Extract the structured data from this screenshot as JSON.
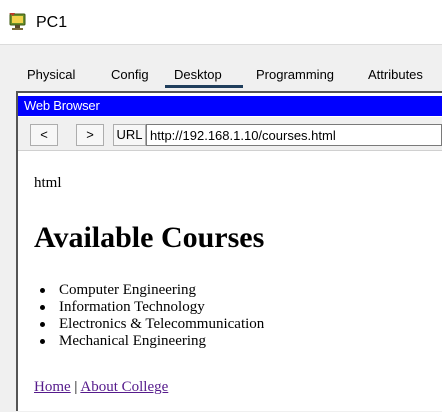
{
  "window": {
    "title": "PC1",
    "icon": "pc-icon"
  },
  "tabs": [
    {
      "label": "Physical"
    },
    {
      "label": "Config"
    },
    {
      "label": "Desktop",
      "active": true
    },
    {
      "label": "Programming"
    },
    {
      "label": "Attributes"
    }
  ],
  "browser": {
    "title": "Web Browser",
    "back_label": "<",
    "forward_label": ">",
    "url_label": "URL",
    "url": "http://192.168.1.10/courses.html",
    "title_bar_color": "#0000ff"
  },
  "page": {
    "doc_label": "html",
    "heading": "Available Courses",
    "courses": [
      "Computer Engineering",
      "Information Technology",
      "Electronics & Telecommunication",
      "Mechanical Engineering"
    ],
    "links": {
      "home": "Home",
      "separator": "|",
      "about": "About College"
    }
  }
}
